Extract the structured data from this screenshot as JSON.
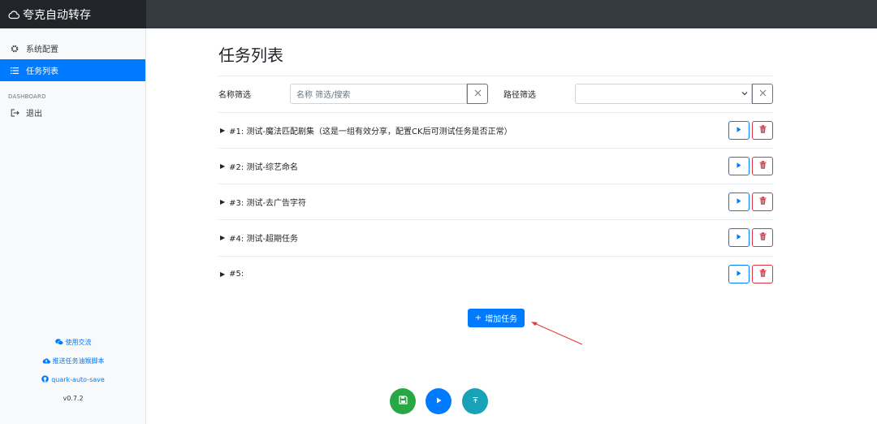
{
  "app": {
    "title": "夸克自动转存"
  },
  "sidebar": {
    "items": [
      {
        "label": "系统配置",
        "icon": "gear-icon",
        "active": false
      },
      {
        "label": "任务列表",
        "icon": "list-icon",
        "active": true
      }
    ],
    "heading": "DASHBOARD",
    "logout": {
      "label": "退出",
      "icon": "logout-icon"
    },
    "footer": {
      "links": [
        {
          "label": "使用交流",
          "icon": "wechat-icon"
        },
        {
          "label": "推送任务油猴脚本",
          "icon": "cloud-upload-icon"
        },
        {
          "label": "quark-auto-save",
          "icon": "github-icon"
        }
      ],
      "version": "v0.7.2"
    }
  },
  "main": {
    "title": "任务列表",
    "filters": {
      "name_label": "名称筛选",
      "name_placeholder": "名称 筛选/搜索",
      "path_label": "路径筛选",
      "path_value": ""
    },
    "tasks": [
      {
        "name": "#1: 测试-魔法匹配剧集（这是一组有效分享，配置CK后可测试任务是否正常）"
      },
      {
        "name": "#2: 测试-综艺命名"
      },
      {
        "name": "#3: 测试-去广告字符"
      },
      {
        "name": "#4: 测试-超期任务"
      },
      {
        "name": "#5:"
      }
    ],
    "add_button": "增加任务"
  },
  "colors": {
    "primary": "#007bff",
    "danger": "#dc3545",
    "success": "#28a745",
    "info": "#17a2b8",
    "topbar": "#343a40",
    "brand": "#212529"
  }
}
